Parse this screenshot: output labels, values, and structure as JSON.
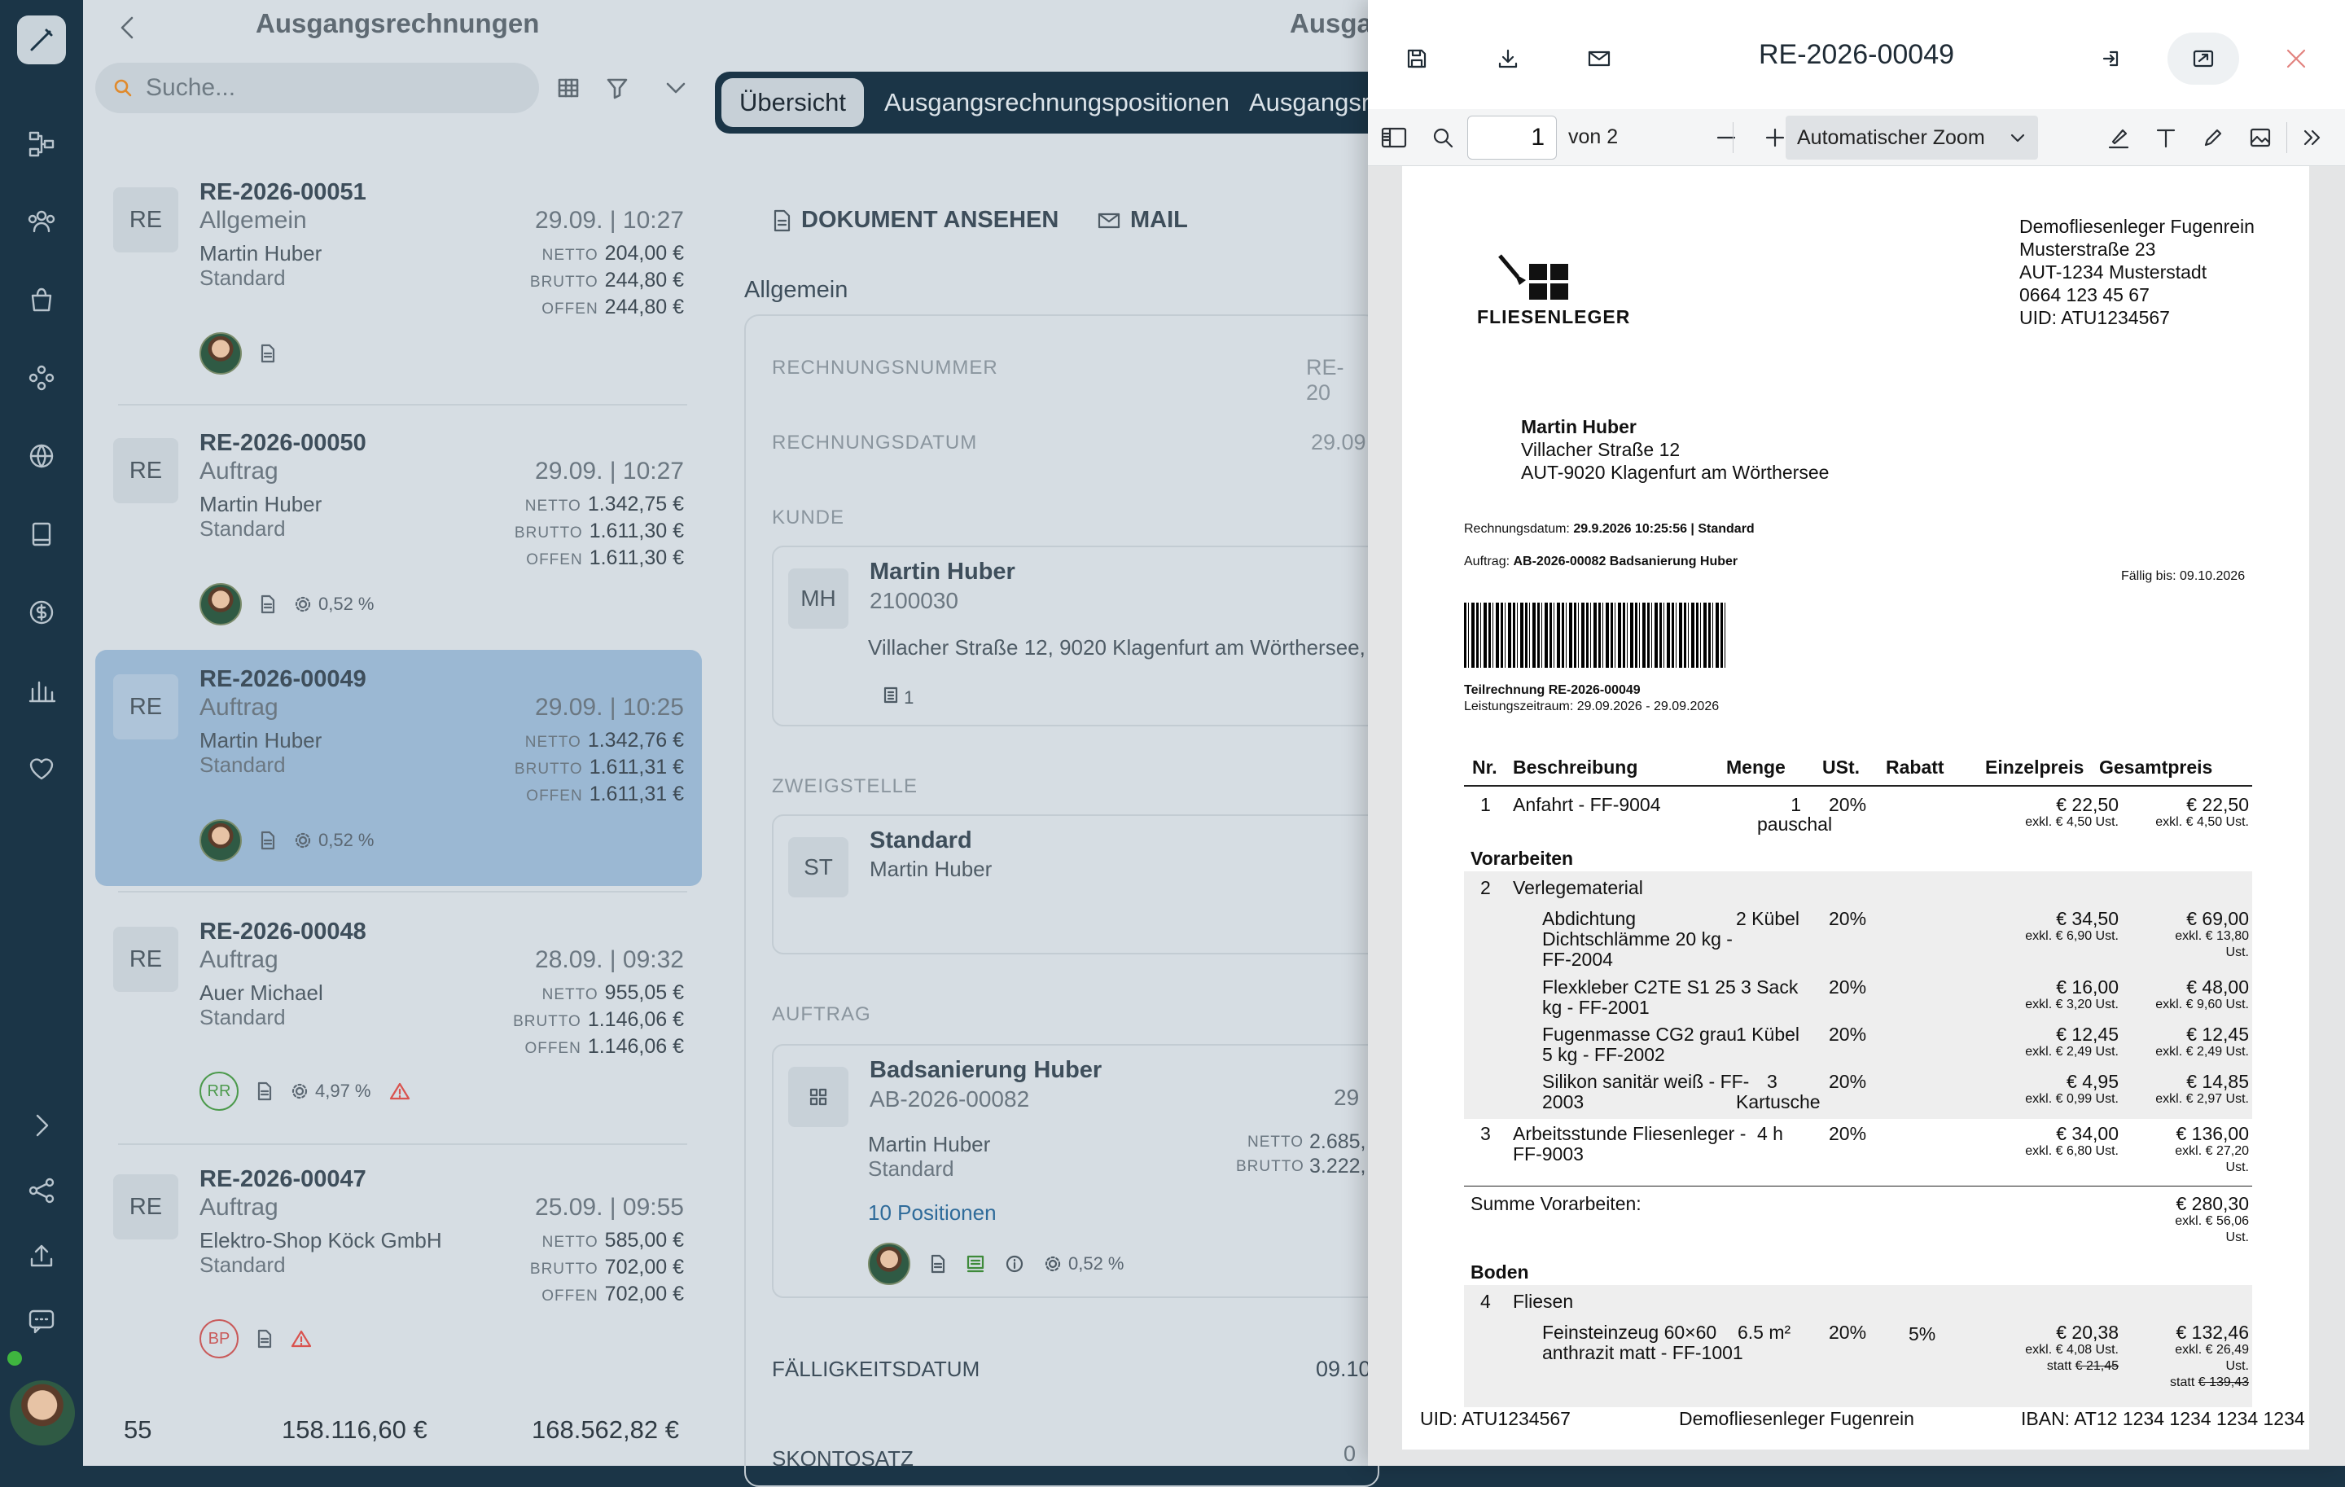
{
  "list": {
    "title": "Ausgangsrechnungen",
    "search_placeholder": "Suche...",
    "labels": {
      "netto": "NETTO",
      "brutto": "BRUTTO",
      "offen": "OFFEN"
    },
    "invoices": [
      {
        "badge": "RE",
        "number": "RE-2026-00051",
        "type": "Allgemein",
        "date": "29.09. | 10:27",
        "customer": "Martin Huber",
        "branch": "Standard",
        "netto": "204,00 €",
        "brutto": "244,80 €",
        "offen": "244,80 €",
        "percent": "",
        "initials": ""
      },
      {
        "badge": "RE",
        "number": "RE-2026-00050",
        "type": "Auftrag",
        "date": "29.09. | 10:27",
        "customer": "Martin Huber",
        "branch": "Standard",
        "netto": "1.342,75 €",
        "brutto": "1.611,30 €",
        "offen": "1.611,30 €",
        "percent": "0,52 %",
        "initials": ""
      },
      {
        "badge": "RE",
        "number": "RE-2026-00049",
        "type": "Auftrag",
        "date": "29.09. | 10:25",
        "customer": "Martin Huber",
        "branch": "Standard",
        "netto": "1.342,76 €",
        "brutto": "1.611,31 €",
        "offen": "1.611,31 €",
        "percent": "0,52 %",
        "initials": ""
      },
      {
        "badge": "RE",
        "number": "RE-2026-00048",
        "type": "Auftrag",
        "date": "28.09. | 09:32",
        "customer": "Auer Michael",
        "branch": "Standard",
        "netto": "955,05 €",
        "brutto": "1.146,06 €",
        "offen": "1.146,06 €",
        "percent": "4,97 %",
        "initials": "RR"
      },
      {
        "badge": "RE",
        "number": "RE-2026-00047",
        "type": "Auftrag",
        "date": "25.09. | 09:55",
        "customer": "Elektro-Shop Köck GmbH",
        "branch": "Standard",
        "netto": "585,00 €",
        "brutto": "702,00 €",
        "offen": "702,00 €",
        "percent": "",
        "initials": "BP"
      }
    ],
    "footer": {
      "count": "55",
      "netto_total": "158.116,60 €",
      "brutto_total": "168.562,82 €"
    }
  },
  "detail": {
    "title": "Ausga",
    "tabs": [
      "Übersicht",
      "Ausgangsrechnungspositionen",
      "Ausgangsr"
    ],
    "actions": {
      "view_doc": "DOKUMENT ANSEHEN",
      "mail": "MAIL"
    },
    "section_general": "Allgemein",
    "fields": {
      "rechnungsnummer": "RECHNUNGSNUMMER",
      "rechnungsnummer_val": "RE-20",
      "rechnungsdatum": "RECHNUNGSDATUM",
      "rechnungsdatum_val": "29.09",
      "kunde": "KUNDE",
      "zweigstelle": "ZWEIGSTELLE",
      "auftrag": "AUFTRAG",
      "faelligkeit": "FÄLLIGKEITSDATUM",
      "faelligkeit_val": "09.10",
      "skonto": "SKONTOSATZ",
      "skonto_val": "0"
    },
    "customer": {
      "badge": "MH",
      "name": "Martin Huber",
      "number": "2100030",
      "address": "Villacher Straße 12, 9020 Klagenfurt am Wörthersee, A",
      "docs": "1"
    },
    "branch": {
      "badge": "ST",
      "name": "Standard",
      "contact": "Martin Huber"
    },
    "order": {
      "name": "Badsanierung Huber",
      "number": "AB-2026-00082",
      "date": "29",
      "customer": "Martin Huber",
      "branch": "Standard",
      "netto_label": "NETTO",
      "netto": "2.685,",
      "brutto_label": "BRUTTO",
      "brutto": "3.222,",
      "positions": "10 Positionen",
      "percent": "0,52 %"
    }
  },
  "pdf": {
    "doc_title": "RE-2026-00049",
    "page": "1",
    "of_pages": "von 2",
    "zoom": "Automatischer Zoom",
    "company": {
      "logo_text": "FLIESENLEGER",
      "name": "Demofliesenleger Fugenrein",
      "street": "Musterstraße 23",
      "city": "AUT-1234 Musterstadt",
      "phone": "0664 123 45 67",
      "uid": "UID: ATU1234567"
    },
    "recipient": {
      "name": "Martin Huber",
      "street": "Villacher Straße 12",
      "city": "AUT-9020 Klagenfurt am Wörthersee"
    },
    "meta": {
      "date_label": "Rechnungsdatum:",
      "date_val": "29.9.2026 10:25:56 | Standard",
      "order_label": "Auftrag:",
      "order_val": "AB-2026-00082 Badsanierung Huber",
      "due": "Fällig bis: 09.10.2026",
      "partial": "Teilrechnung RE-2026-00049",
      "period": "Leistungszeitraum: 29.09.2026 - 29.09.2026"
    },
    "table": {
      "headers": {
        "nr": "Nr.",
        "desc": "Beschreibung",
        "qty": "Menge",
        "vat": "USt.",
        "disc": "Rabatt",
        "unit": "Einzelpreis",
        "total": "Gesamtpreis"
      },
      "r1": {
        "nr": "1",
        "desc": "Anfahrt - FF-9004",
        "qty1": "1",
        "qty2": "pauschal",
        "vat": "20%",
        "unit": "€ 22,50",
        "unit_ex": "exkl. € 4,50 Ust.",
        "total": "€ 22,50",
        "total_ex": "exkl. € 4,50 Ust."
      },
      "group1": "Vorarbeiten",
      "r2": {
        "nr": "2",
        "desc": "Verlegematerial"
      },
      "s1": {
        "d1": "Abdichtung",
        "d2": "Dichtschlämme 20 kg -",
        "d3": "FF-2004",
        "qty": "2 Kübel",
        "vat": "20%",
        "unit": "€ 34,50",
        "unit_ex": "exkl. € 6,90 Ust.",
        "total": "€ 69,00",
        "total_ex": "exkl. € 13,80",
        "total_ex2": "Ust."
      },
      "s2": {
        "d1": "Flexkleber C2TE S1 25",
        "d2": "kg - FF-2001",
        "qty": "3 Sack",
        "vat": "20%",
        "unit": "€ 16,00",
        "unit_ex": "exkl. € 3,20 Ust.",
        "total": "€ 48,00",
        "total_ex": "exkl. € 9,60 Ust."
      },
      "s3": {
        "d1": "Fugenmasse CG2 grau",
        "d2": "5 kg - FF-2002",
        "qty": "1 Kübel",
        "vat": "20%",
        "unit": "€ 12,45",
        "unit_ex": "exkl. € 2,49 Ust.",
        "total": "€ 12,45",
        "total_ex": "exkl. € 2,49 Ust."
      },
      "s4": {
        "d1": "Silikon sanitär weiß - FF-",
        "d2": "2003",
        "qty1": "3",
        "qty2": "Kartusche",
        "vat": "20%",
        "unit": "€ 4,95",
        "unit_ex": "exkl. € 0,99 Ust.",
        "total": "€ 14,85",
        "total_ex": "exkl. € 2,97 Ust."
      },
      "r3": {
        "nr": "3",
        "d1": "Arbeitsstunde Fliesenleger -",
        "d2": "FF-9003",
        "qty": "4 h",
        "vat": "20%",
        "unit": "€ 34,00",
        "unit_ex": "exkl. € 6,80 Ust.",
        "total": "€ 136,00",
        "total_ex": "exkl. € 27,20",
        "total_ex2": "Ust."
      },
      "sum1": {
        "label": "Summe Vorarbeiten:",
        "total": "€ 280,30",
        "ex": "exkl. € 56,06",
        "ex2": "Ust."
      },
      "group2": "Boden",
      "r4": {
        "nr": "4",
        "desc": "Fliesen"
      },
      "s5": {
        "d1": "Feinsteinzeug 60×60",
        "d2": "anthrazit matt - FF-1001",
        "qty": "6.5 m²",
        "vat": "20%",
        "disc": "5%",
        "unit": "€ 20,38",
        "unit_ex": "exkl. € 4,08 Ust.",
        "unit_statt": "statt",
        "unit_old": "€ 21,45",
        "total": "€ 132,46",
        "total_ex": "exkl. € 26,49",
        "total_ex2": "Ust.",
        "total_statt": "statt",
        "total_old": "€ 139,43"
      }
    },
    "footer": {
      "uid": "UID: ATU1234567",
      "name": "Demofliesenleger Fugenrein",
      "iban": "IBAN: AT12 1234 1234 1234 1234"
    }
  }
}
